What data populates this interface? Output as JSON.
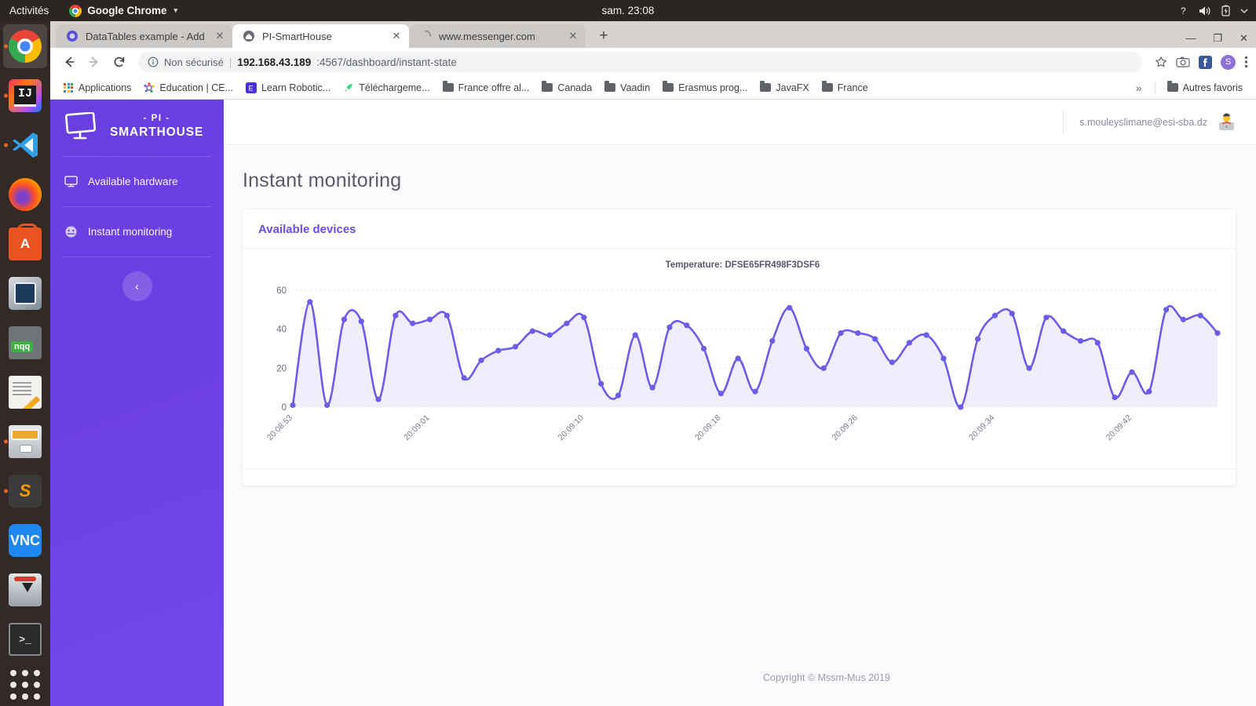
{
  "os_bar": {
    "activities": "Activités",
    "app_menu": "Google Chrome",
    "app_menu_caret": "▾",
    "clock": "sam. 23:08",
    "icons": [
      "help-icon",
      "volume-icon",
      "battery-icon",
      "dropdown-caret-icon"
    ]
  },
  "dock": {
    "items": [
      {
        "name": "google-chrome",
        "label": "Chrome",
        "running": true,
        "active": true
      },
      {
        "name": "intellij-idea",
        "label": "IJ",
        "running": true,
        "active": false
      },
      {
        "name": "visual-studio-code",
        "label": "VS",
        "running": true,
        "active": false
      },
      {
        "name": "firefox",
        "label": "Firefox",
        "running": false,
        "active": false
      },
      {
        "name": "ubuntu-software",
        "label": "A",
        "running": false,
        "active": false
      },
      {
        "name": "virtualbox",
        "label": "VBox",
        "running": false,
        "active": false
      },
      {
        "name": "notepadqq",
        "label": "nqq",
        "running": false,
        "active": false
      },
      {
        "name": "notes",
        "label": "Notes",
        "running": false,
        "active": false
      },
      {
        "name": "file-manager",
        "label": "Files",
        "running": true,
        "active": false
      },
      {
        "name": "sublime-text",
        "label": "S",
        "running": true,
        "active": false
      },
      {
        "name": "vnc-viewer",
        "label": "VNC",
        "running": false,
        "active": false
      },
      {
        "name": "transmission",
        "label": "Transmission",
        "running": false,
        "active": false
      },
      {
        "name": "terminal",
        "label": ">_",
        "running": false,
        "active": false
      }
    ],
    "show_applications": "show-applications-grid"
  },
  "browser": {
    "tabs": [
      {
        "title": "DataTables example - Add",
        "favicon": "datatables-icon",
        "active": false
      },
      {
        "title": "PI-SmartHouse",
        "favicon": "smarthouse-icon",
        "active": true
      },
      {
        "title": "www.messenger.com",
        "favicon": "messenger-loading-icon",
        "active": false
      }
    ],
    "new_tab_label": "+",
    "window_controls": {
      "minimize": "—",
      "maximize": "❐",
      "close": "✕"
    },
    "nav": {
      "back": "←",
      "forward": "→",
      "reload": "↻"
    },
    "omnibox": {
      "security_label": "Non sécurisé",
      "divider": "|",
      "url_host": "192.168.43.189",
      "url_rest": ":4567/dashboard/instant-state"
    },
    "toolbar_icons": [
      "star-icon",
      "camera-icon",
      "facebook-icon",
      "profile-avatar",
      "menu-kebab-icon"
    ],
    "profile_initial": "S",
    "bookmarks": [
      {
        "label": "Applications",
        "icon": "apps-grid-icon"
      },
      {
        "label": "Education | CE...",
        "icon": "education-icon"
      },
      {
        "label": "Learn Robotic...",
        "icon": "learn-robotics-icon"
      },
      {
        "label": "Téléchargeme...",
        "icon": "rocket-icon"
      },
      {
        "label": "France offre al...",
        "icon": "folder-icon"
      },
      {
        "label": "Canada",
        "icon": "folder-icon"
      },
      {
        "label": "Vaadin",
        "icon": "folder-icon"
      },
      {
        "label": "Erasmus prog...",
        "icon": "folder-icon"
      },
      {
        "label": "JavaFX",
        "icon": "folder-icon"
      },
      {
        "label": "France",
        "icon": "folder-icon"
      }
    ],
    "bookmarks_overflow": "»",
    "other_bookmarks": {
      "label": "Autres favoris",
      "icon": "folder-icon"
    }
  },
  "app": {
    "sidebar": {
      "brand_top": "- PI -",
      "brand_main": "SMARTHOUSE",
      "brand_icon": "monitor-icon",
      "items": [
        {
          "label": "Available hardware",
          "icon": "monitor-icon"
        },
        {
          "label": "Instant monitoring",
          "icon": "gauge-icon"
        }
      ],
      "collapse_button": "‹"
    },
    "header": {
      "user_email": "s.mouleyslimane@esi-sba.dz",
      "avatar": "user-avatar-icon"
    },
    "page_title": "Instant monitoring",
    "card_title": "Available devices",
    "footer": "Copyright © Mssm-Mus 2019"
  },
  "colors": {
    "brand_purple": "#6b4ce6",
    "sidebar_purple": "#6c3fe2",
    "chart_line": "#6c5ce7",
    "chart_fill": "#f0eefc",
    "page_bg": "#fbfbfd"
  },
  "chart_data": {
    "type": "line",
    "title": "Temperature: DFSE65FR498F3DSF6",
    "xlabel": "",
    "ylabel": "",
    "ylim": [
      0,
      62
    ],
    "yticks": [
      0,
      20,
      40,
      60
    ],
    "grid": true,
    "legend": false,
    "area_fill": true,
    "xtick_labels": [
      "20:08:53",
      "20:09:01",
      "20:09:10",
      "20:09:18",
      "20:09:26",
      "20:09:34",
      "20:09:42"
    ],
    "xtick_indices": [
      0,
      8,
      17,
      25,
      33,
      41,
      49
    ],
    "series": [
      {
        "name": "Temperature",
        "values": [
          1,
          54,
          1,
          45,
          44,
          4,
          47,
          43,
          45,
          47,
          15,
          24,
          29,
          31,
          39,
          37,
          43,
          46,
          12,
          6,
          37,
          10,
          41,
          42,
          30,
          7,
          25,
          8,
          34,
          51,
          30,
          20,
          38,
          38,
          35,
          23,
          33,
          37,
          25,
          0,
          35,
          47,
          48,
          20,
          46,
          39,
          34,
          33,
          5,
          18,
          8,
          50,
          45,
          47,
          38
        ]
      }
    ]
  }
}
